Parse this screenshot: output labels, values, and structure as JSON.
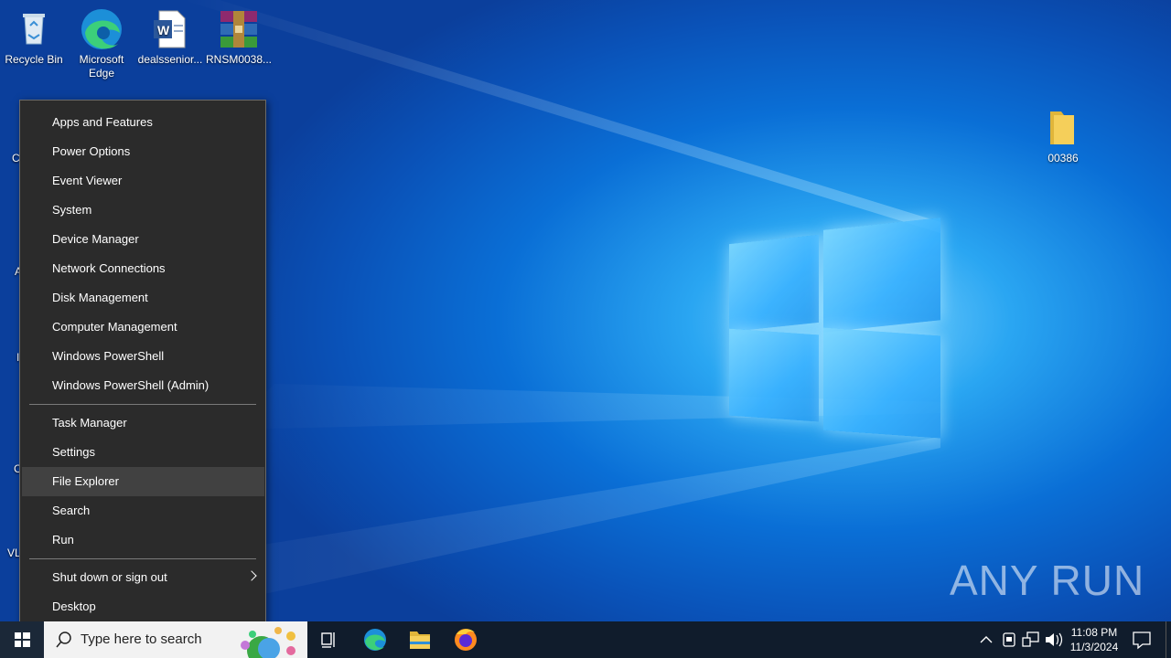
{
  "desktop": {
    "icons": [
      {
        "name": "recycle-bin",
        "label": "Recycle Bin"
      },
      {
        "name": "microsoft-edge",
        "label": "Microsoft Edge"
      },
      {
        "name": "word-document",
        "label": "dealssenior..."
      },
      {
        "name": "winrar-archive",
        "label": "RNSM0038..."
      },
      {
        "name": "folder",
        "label": "00386"
      }
    ],
    "partial_labels": [
      "C",
      "A",
      "I",
      "C",
      "VL"
    ]
  },
  "context_menu": {
    "items": [
      "Apps and Features",
      "Power Options",
      "Event Viewer",
      "System",
      "Device Manager",
      "Network Connections",
      "Disk Management",
      "Computer Management",
      "Windows PowerShell",
      "Windows PowerShell (Admin)",
      "Task Manager",
      "Settings",
      "File Explorer",
      "Search",
      "Run",
      "Shut down or sign out",
      "Desktop"
    ],
    "highlighted": "File Explorer"
  },
  "taskbar": {
    "search_placeholder": "Type here to search",
    "time": "11:08 PM",
    "date": "11/3/2024",
    "pinned": [
      "task-view",
      "edge",
      "file-explorer",
      "firefox"
    ]
  },
  "watermark": "ANY RUN",
  "colors": {
    "menu_bg": "#2b2b2b",
    "highlight": "#414141",
    "taskbar": "#101c2c"
  }
}
